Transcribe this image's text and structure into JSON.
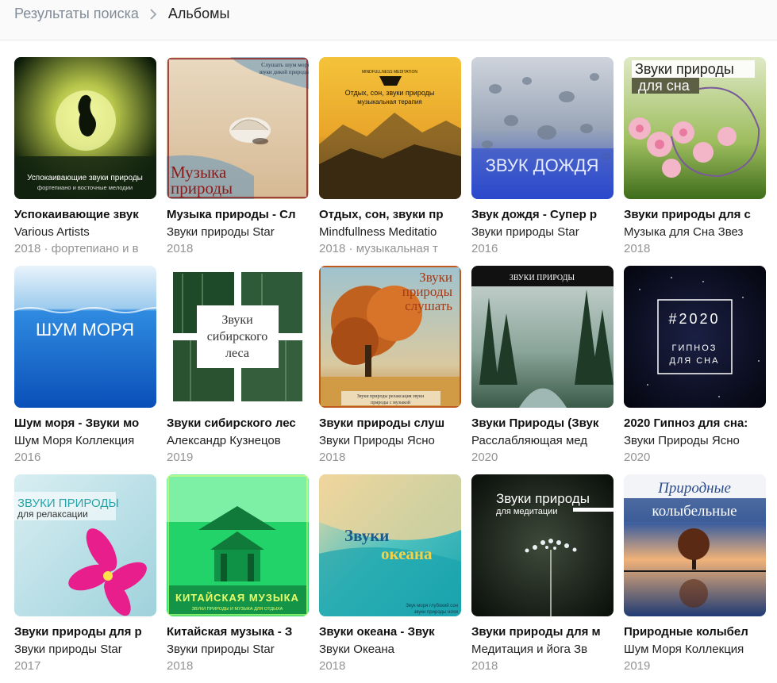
{
  "breadcrumb": {
    "parent": "Результаты поиска",
    "current": "Альбомы"
  },
  "albums": [
    {
      "title": "Успокаивающие звук",
      "artist": "Various Artists",
      "meta": "2018 · фортепиано и в",
      "cover": {
        "line1": "Успокаивающие звуки природы",
        "line2": "фортепиано и восточные мелодии"
      }
    },
    {
      "title": "Музыка природы - Сл",
      "artist": "Звуки природы Star",
      "meta": "2018",
      "cover": {
        "line1": "Музыка",
        "line2": "природы",
        "top1": "Слушать шум моря",
        "top2": "звуки дикой природы"
      }
    },
    {
      "title": "Отдых, сон, звуки пр",
      "artist": "Mindfullness Meditatio",
      "meta": "2018 · музыкальная т",
      "cover": {
        "line1": "Отдых, сон, звуки природы",
        "line2": "музыкальная терапия",
        "small": "MINDFULLNESS MEDITATION"
      }
    },
    {
      "title": "Звук дождя - Супер р",
      "artist": "Звуки природы Star",
      "meta": "2016",
      "cover": {
        "line1": "ЗВУК ДОЖДЯ"
      }
    },
    {
      "title": "Звуки природы для с",
      "artist": "Музыка для Сна Звез",
      "meta": "2018",
      "cover": {
        "line1": "Звуки природы",
        "line2": "для сна"
      }
    },
    {
      "title": "Шум моря - Звуки мо",
      "artist": "Шум Моря Коллекция",
      "meta": "2016",
      "cover": {
        "line1": "ШУМ МОРЯ"
      }
    },
    {
      "title": "Звуки сибирского лес",
      "artist": "Александр Кузнецов",
      "meta": "2019",
      "cover": {
        "line1": "Звуки",
        "line2": "сибирского",
        "line3": "леса"
      }
    },
    {
      "title": "Звуки природы слуш",
      "artist": "Звуки Природы Ясно",
      "meta": "2018",
      "cover": {
        "line1": "Звуки",
        "line2": "природы",
        "line3": "слушать",
        "bottom1": "Звуки природы релаксация звуки",
        "bottom2": "природы с музыкой"
      }
    },
    {
      "title": "Звуки Природы (Звук",
      "artist": "Расслабляющая мед",
      "meta": "2020",
      "cover": {
        "line1": "ЗВУКИ ПРИРОДЫ"
      }
    },
    {
      "title": "2020 Гипноз для сна:",
      "artist": "Звуки Природы Ясно",
      "meta": "2020",
      "cover": {
        "line1": "#2020",
        "line2": "ГИПНОЗ",
        "line3": "ДЛЯ СНА"
      }
    },
    {
      "title": "Звуки природы для р",
      "artist": "Звуки природы Star",
      "meta": "2017",
      "cover": {
        "line1": "ЗВУКИ ПРИРОДЫ",
        "line2": "для релаксации"
      }
    },
    {
      "title": "Китайская музыка - З",
      "artist": "Звуки природы Star",
      "meta": "2018",
      "cover": {
        "line1": "КИТАЙСКАЯ МУЗЫКА",
        "line2": "ЗВУКИ ПРИРОДЫ И МУЗЫКА ДЛЯ ОТДЫХА"
      }
    },
    {
      "title": "Звуки океана - Звук",
      "artist": "Звуки Океана",
      "meta": "2018",
      "cover": {
        "line1": "Звуки",
        "line2": "океана",
        "bottom1": "Звук моря глубокий сон",
        "bottom2": "звуки природы ночи"
      }
    },
    {
      "title": "Звуки природы для м",
      "artist": "Медитация и йога Зв",
      "meta": "2018",
      "cover": {
        "line1": "Звуки природы",
        "line2": "для медитации"
      }
    },
    {
      "title": "Природные колыбел",
      "artist": "Шум Моря Коллекция",
      "meta": "2019",
      "cover": {
        "line1": "Природные",
        "line2": "колыбельные"
      }
    }
  ]
}
